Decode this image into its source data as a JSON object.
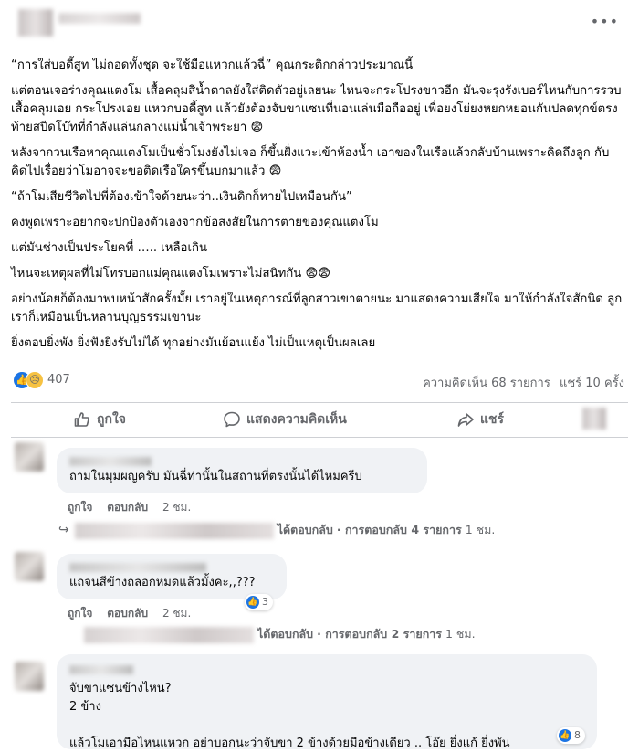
{
  "post": {
    "more_icon": "more-horizontal-icon",
    "paragraphs": [
      "“การใส่บอดี้สูท ไม่ถอดทั้งชุด จะใช้มือแหวกแล้วฉี่” คุณกระติกกล่าวประมาณนี้",
      "แต่ตอนเจอร่างคุณแตงโม เสื้อคลุมสีน้ำตาลยังใส่ติดตัวอยู่เลยนะ ไหนจะกระโปรงขาวอีก มันจะรุงรังเบอร์ไหนกับการรวบเสื้อคลุมเอย กระโปรงเอย แหวกบอดี้สูท แล้วยังต้องจับขาแซนที่นอนเล่นมือถืออยู่ เพื่อยงโย่ยงหยกหย่อนกันปลดทุกข์ตรงท้ายสปีดโบ๊ทที่กำลังแล่นกลางแม่น้ำเจ้าพระยา 😨",
      "หลังจากวนเรือหาคุณแตงโมเป็นชั่วโมงยังไม่เจอ ก็ขึ้นฝั่งแวะเข้าห้องน้ำ เอาของในเรือแล้วกลับบ้านเพราะคิดถึงลูก กับคิดไปเรื่อยว่าโมอาจจะขอติดเรือใครขึ้นบกมาแล้ว 😨",
      "“ถ้าโมเสียชีวิตไปพี่ต้องเข้าใจด้วยนะว่า..เงินดิกก็หายไปเหมือนกัน”",
      "คงพูดเพราะอยากจะปกป้องตัวเองจากข้อสงสัยในการตายของคุณแตงโม",
      "แต่มันช่างเป็นประโยคที่ ….. เหลือเกิน",
      "ไหนจะเหตุผลที่ไม่โทรบอกแม่คุณแตงโมเพราะไม่สนิทกัน 😨😨",
      "อย่างน้อยก็ต้องมาพบหน้าสักครั้งมั้ย เราอยู่ในเหตุการณ์ที่ลูกสาวเขาตายนะ มาแสดงความเสียใจ มาให้กำลังใจสักนิด ลูกเราก็เหมือนเป็นหลานบุญธรรมเขานะ",
      "ยิ่งตอบยิ่งพัง ยิ่งฟังยิ่งรับไม่ได้ ทุกอย่างมันย้อนแย้ง ไม่เป็นเหตุเป็นผลเลย"
    ]
  },
  "stats": {
    "reaction_icons": [
      "like-reaction-icon",
      "sad-reaction-icon"
    ],
    "reaction_count": "407",
    "comments_text": "ความคิดเห็น 68 รายการ",
    "shares_text": "แชร์ 10 ครั้ง"
  },
  "actions": {
    "like_label": "ถูกใจ",
    "like_icon": "thumbs-up-icon",
    "comment_label": "แสดงความคิดเห็น",
    "comment_icon": "comment-bubble-icon",
    "share_label": "แชร์",
    "share_icon": "share-arrow-icon"
  },
  "comments": [
    {
      "text": "ถามในมุมผญครับ มันฉี่ท่านั้นในสถานที่ตรงนั้นได้ไหมครีบ",
      "like_label": "ถูกใจ",
      "reply_label": "ตอบกลับ",
      "time": "2 ชม.",
      "reply_summary": {
        "replied_label": "ได้ตอบกลับ",
        "count_label": "· การตอบกลับ 4 รายการ",
        "time": "1 ชม."
      }
    },
    {
      "text": "แถจนสีข้างถลอกหมดแล้วมั้งคะ,,???",
      "like_label": "ถูกใจ",
      "reply_label": "ตอบกลับ",
      "time": "2 ชม.",
      "reaction_count": "3",
      "reply_summary": {
        "replied_label": "ได้ตอบกลับ",
        "count_label": "· การตอบกลับ 2 รายการ",
        "time": "1 ชม."
      }
    },
    {
      "text": "จับขาแซนข้างไหน?\n2 ข้าง\n\nแล้วโมเอามือไหนแหวก อย่าบอกนะว่าจับขา 2 ข้างด้วยมือข้างเดียว .. โอ๊ย ยิ่งแก้ ยิ่งพัน",
      "reaction_count": "8"
    }
  ],
  "colors": {
    "accent": "#1b74e4",
    "bubble": "#f0f2f5",
    "secondary_text": "#65676b"
  }
}
